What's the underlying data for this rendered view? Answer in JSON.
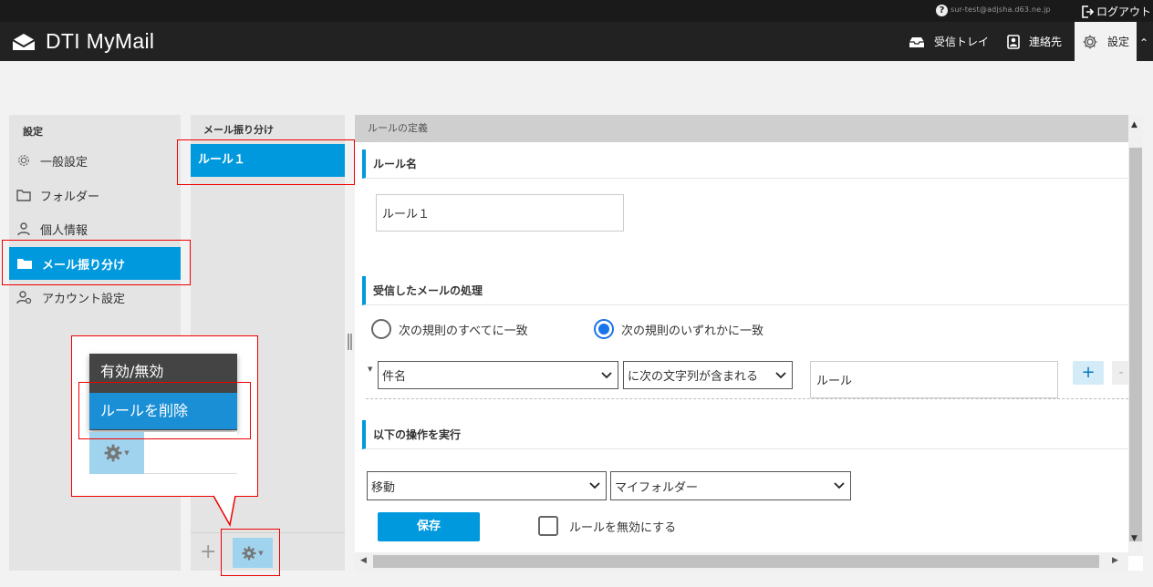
{
  "topbar": {
    "help": "?",
    "user_email": "sur-test@adjsha.d63.ne.jp",
    "logout": "ログアウト"
  },
  "header": {
    "app_title": "DTI MyMail",
    "inbox": "受信トレイ",
    "contacts": "連絡先",
    "settings": "設定"
  },
  "left_panel": {
    "title": "設定",
    "items": [
      {
        "label": "一般設定",
        "icon": "gear-icon"
      },
      {
        "label": "フォルダー",
        "icon": "folder-icon"
      },
      {
        "label": "個人情報",
        "icon": "person-icon"
      },
      {
        "label": "メール振り分け",
        "icon": "folder-icon",
        "active": true
      },
      {
        "label": "アカウント設定",
        "icon": "account-settings-icon"
      }
    ]
  },
  "middle_panel": {
    "title": "メール振り分け",
    "rules": [
      "ルール１"
    ],
    "add": "+"
  },
  "popup_menu": {
    "items": [
      "有効/無効",
      "ルールを削除"
    ]
  },
  "rule_definition": {
    "header": "ルールの定義",
    "rule_name_section": "ルール名",
    "rule_name_value": "ルール１",
    "processing_section": "受信したメールの処理",
    "radio_all": "次の規則のすべてに一致",
    "radio_any": "次の規則のいずれかに一致",
    "condition_field": "件名",
    "condition_operator": "に次の文字列が含まれる",
    "condition_value": "ルール",
    "add_condition": "+",
    "remove_condition": "-",
    "action_section": "以下の操作を実行",
    "action_type": "移動",
    "action_folder": "マイフォルダー",
    "save": "保存",
    "disable_rule": "ルールを無効にする"
  },
  "colors": {
    "accent": "#0099dd",
    "header_bg": "#222222",
    "highlight": "#ee0000"
  }
}
